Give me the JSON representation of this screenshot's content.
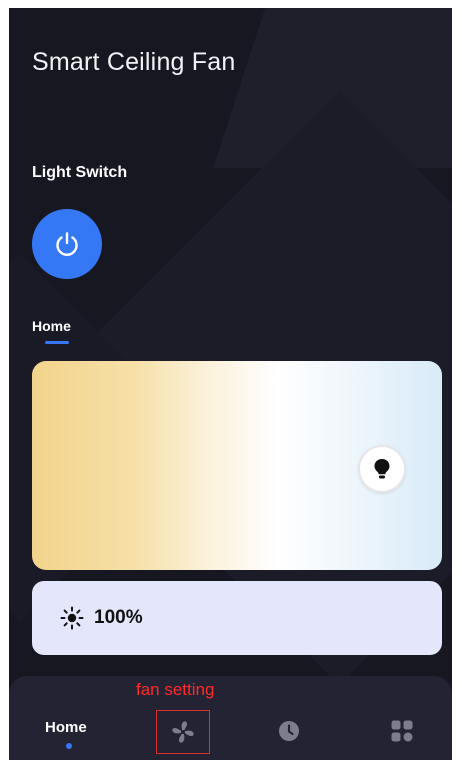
{
  "app": {
    "title": "Smart Ceiling Fan"
  },
  "light_switch": {
    "label": "Light Switch",
    "icon": "power-icon",
    "color": "#3478f6"
  },
  "tabs": {
    "home_label": "Home"
  },
  "color_temperature": {
    "warm_color": "#f2d38b",
    "cool_color": "#d8ebf8",
    "handle_icon": "lightbulb-icon"
  },
  "brightness": {
    "value": "100%",
    "icon": "sun-icon"
  },
  "bottom_nav": {
    "home_label": "Home",
    "items": [
      {
        "icon": "fan-icon"
      },
      {
        "icon": "clock-icon"
      },
      {
        "icon": "grid-icon"
      }
    ]
  },
  "annotation": {
    "text": "fan setting",
    "color": "#ff2a2a"
  }
}
